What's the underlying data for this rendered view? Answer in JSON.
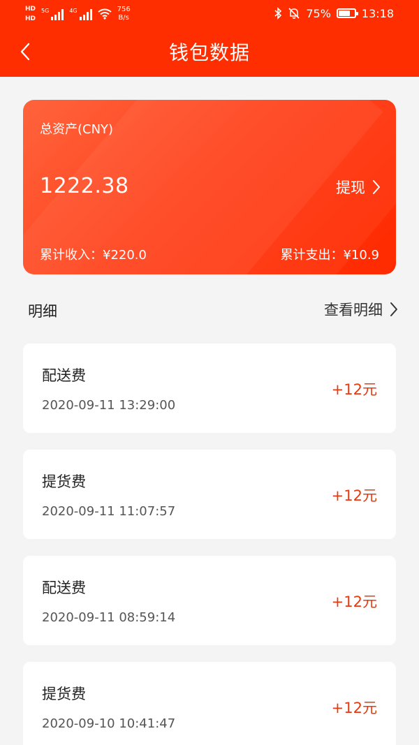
{
  "status_bar": {
    "hd_top": "HD",
    "hd_bottom": "HD",
    "net_5g": "5G",
    "net_4g": "4G",
    "speed_value": "756",
    "speed_unit": "B/s",
    "battery_percent": "75%",
    "battery_level": 0.75,
    "time": "13:18"
  },
  "nav": {
    "title": "钱包数据"
  },
  "wallet": {
    "total_label": "总资产(CNY)",
    "total_value": "1222.38",
    "withdraw_label": "提现",
    "income_label": "累计收入：¥220.0",
    "expense_label": "累计支出：¥10.9"
  },
  "details": {
    "title": "明细",
    "view_all_label": "查看明细"
  },
  "transactions": [
    {
      "name": "配送费",
      "time": "2020-09-11 13:29:00",
      "amount": "+12元"
    },
    {
      "name": "提货费",
      "time": "2020-09-11 11:07:57",
      "amount": "+12元"
    },
    {
      "name": "配送费",
      "time": "2020-09-11 08:59:14",
      "amount": "+12元"
    },
    {
      "name": "提货费",
      "time": "2020-09-10 10:41:47",
      "amount": "+12元"
    }
  ],
  "colors": {
    "brand": "#ff2e00",
    "amount": "#e8380d",
    "background": "#f4f4f4"
  }
}
